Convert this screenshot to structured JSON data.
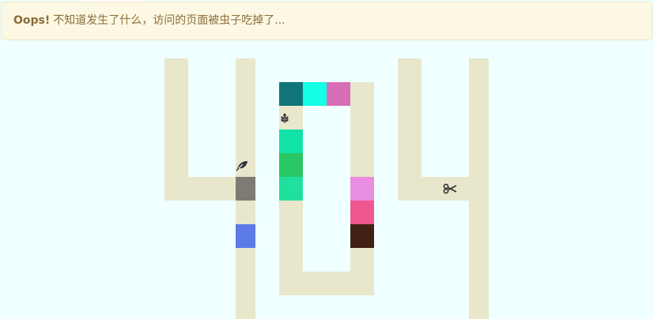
{
  "alert": {
    "title": "Oops!",
    "message": "不知道发生了什么，访问的页面被虫子吃掉了..."
  },
  "colors": {
    "background": "#f0ffff",
    "track": "#e8e7cc",
    "alert_bg": "#fcf8e3",
    "alert_text": "#8a6d3b",
    "tiles": [
      "#0f7579",
      "#14ffe6",
      "#d66fb5",
      "#12e2a6",
      "#28c764",
      "#21e09e",
      "#7f7a74",
      "#5c7be6",
      "#e98ee0",
      "#f0568f",
      "#402012"
    ]
  },
  "icons": [
    "leaf-sprout-icon",
    "leaf-icon",
    "scissors-icon"
  ]
}
